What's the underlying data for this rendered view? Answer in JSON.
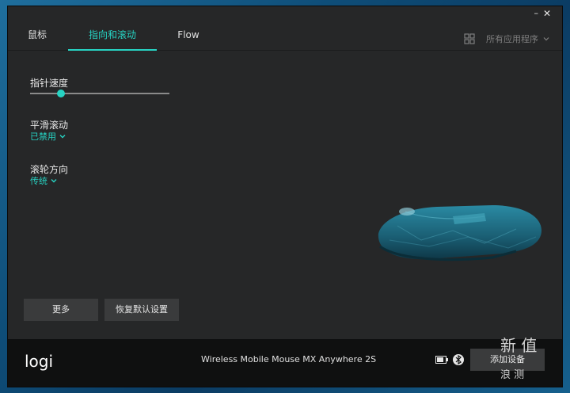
{
  "tabs": [
    "鼠标",
    "指向和滚动",
    "Flow"
  ],
  "active_tab_index": 1,
  "apps_dropdown_label": "所有应用程序",
  "window_controls": {
    "minimize": "–",
    "close": "✕"
  },
  "settings": {
    "pointer_speed": {
      "title": "指针速度",
      "value_fraction": 0.22
    },
    "smooth_scroll": {
      "title": "平滑滚动",
      "value": "已禁用"
    },
    "scroll_direction": {
      "title": "滚轮方向",
      "value": "传统"
    }
  },
  "buttons": {
    "more": "更多",
    "restore_defaults": "恢复默认设置",
    "add_device": "添加设备"
  },
  "footer": {
    "logo_text": "logi",
    "device_name": "Wireless Mobile Mouse MX Anywhere 2S"
  },
  "watermark": {
    "main": "新 值",
    "sub": "浪 测"
  },
  "colors": {
    "accent": "#27d3c3",
    "window_bg": "#262728",
    "footer_bg": "#0f1010",
    "mouse": "#1d6a80"
  }
}
